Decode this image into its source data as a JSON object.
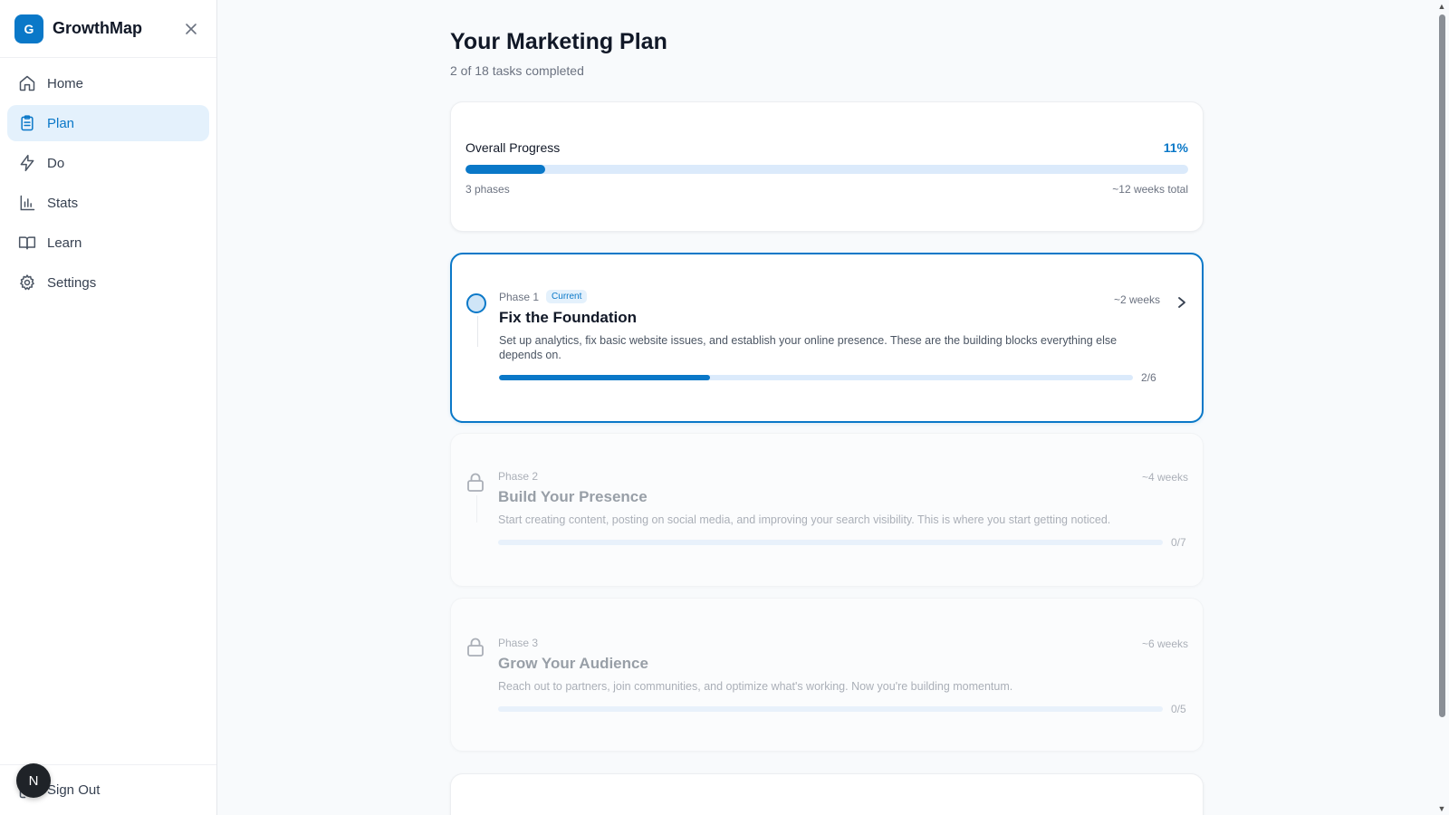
{
  "app": {
    "logo_letter": "G",
    "name": "GrowthMap"
  },
  "sidebar": {
    "items": [
      {
        "label": "Home",
        "icon": "home-icon"
      },
      {
        "label": "Plan",
        "icon": "clipboard-icon",
        "active": true
      },
      {
        "label": "Do",
        "icon": "lightning-icon"
      },
      {
        "label": "Stats",
        "icon": "bar-chart-icon"
      },
      {
        "label": "Learn",
        "icon": "book-icon"
      },
      {
        "label": "Settings",
        "icon": "gear-icon"
      }
    ],
    "sign_out": "Sign Out",
    "avatar_letter": "N"
  },
  "page": {
    "title": "Your Marketing Plan",
    "subtitle": "2 of 18 tasks completed"
  },
  "overall": {
    "label": "Overall Progress",
    "percent_text": "11%",
    "percent": 11,
    "phases_text": "3 phases",
    "total_text": "~12 weeks total"
  },
  "phases": [
    {
      "label": "Phase 1",
      "badge": "Current",
      "weeks": "~2 weeks",
      "title": "Fix the Foundation",
      "description": "Set up analytics, fix basic website issues, and establish your online presence. These are the building blocks everything else depends on.",
      "count": "2/6",
      "progress": 0.333
    },
    {
      "label": "Phase 2",
      "weeks": "~4 weeks",
      "title": "Build Your Presence",
      "description": "Start creating content, posting on social media, and improving your search visibility. This is where you start getting noticed.",
      "count": "0/7",
      "progress": 0
    },
    {
      "label": "Phase 3",
      "weeks": "~6 weeks",
      "title": "Grow Your Audience",
      "description": "Reach out to partners, join communities, and optimize what's working. Now you're building momentum.",
      "count": "0/5",
      "progress": 0
    }
  ],
  "colors": {
    "accent": "#0a78c8",
    "track": "#dbeafb",
    "active_bg": "#e4f1fc"
  }
}
